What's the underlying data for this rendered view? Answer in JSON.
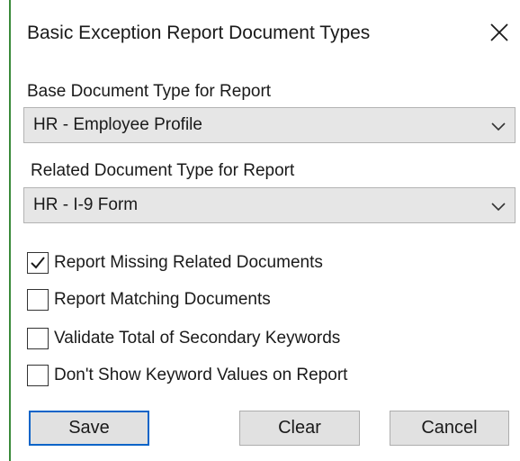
{
  "dialog": {
    "title": "Basic Exception Report Document Types"
  },
  "base_doc": {
    "label": "Base Document Type for Report",
    "value": "HR - Employee Profile"
  },
  "related_doc": {
    "label": "Related Document Type for Report",
    "value": "HR - I-9 Form"
  },
  "options": [
    {
      "label": "Report Missing Related Documents",
      "checked": true
    },
    {
      "label": "Report Matching Documents",
      "checked": false
    },
    {
      "label": "Validate Total of Secondary Keywords",
      "checked": false
    },
    {
      "label": "Don't Show Keyword Values on Report",
      "checked": false
    }
  ],
  "buttons": {
    "save": "Save",
    "clear": "Clear",
    "cancel": "Cancel"
  },
  "icons": {
    "close": "close-icon",
    "dropdown": "chevron-down-icon",
    "check": "checkmark-icon"
  },
  "colors": {
    "default_button_border": "#0a64c8",
    "window_border": "#3a8a3a",
    "select_background": "#e6e6e6"
  }
}
